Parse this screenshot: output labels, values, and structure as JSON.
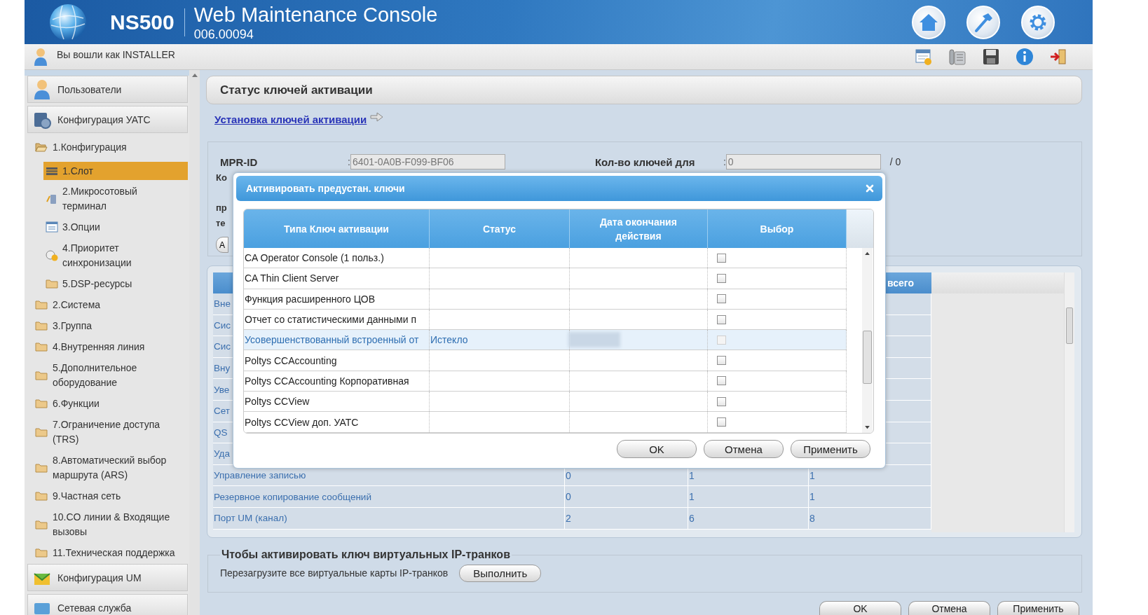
{
  "header": {
    "product": "NS500",
    "title": "Web Maintenance Console",
    "version": "006.00094"
  },
  "user_bar": {
    "text": "Вы вошли как INSTALLER"
  },
  "sidebar": {
    "sections": [
      {
        "label": "Пользователи",
        "kind": "users"
      },
      {
        "label": "Конфигурация УАТС",
        "kind": "pbx",
        "tree": [
          {
            "label": "1.Конфигурация",
            "expanded": true,
            "children": [
              {
                "label": "1.Слот",
                "kind": "slot",
                "selected": true
              },
              {
                "label": "2.Микросотовый терминал",
                "kind": "cell",
                "selected": false
              },
              {
                "label": "3.Опции",
                "kind": "options",
                "selected": false
              },
              {
                "label": "4.Приоритет синхронизации",
                "kind": "sync",
                "selected": false
              },
              {
                "label": "5.DSP-ресурсы",
                "kind": "folder",
                "selected": false
              }
            ]
          },
          {
            "label": "2.Система",
            "expanded": false
          },
          {
            "label": "3.Группа",
            "expanded": false
          },
          {
            "label": "4.Внутренняя линия",
            "expanded": false
          },
          {
            "label": "5.Дополнительное оборудование",
            "expanded": false
          },
          {
            "label": "6.Функции",
            "expanded": false
          },
          {
            "label": "7.Ограничение доступа (TRS)",
            "expanded": false
          },
          {
            "label": "8.Автоматический выбор маршрута (ARS)",
            "expanded": false
          },
          {
            "label": "9.Частная сеть",
            "expanded": false
          },
          {
            "label": "10.CO линии & Входящие вызовы",
            "expanded": false
          },
          {
            "label": "11.Техническая поддержка",
            "expanded": false
          }
        ]
      },
      {
        "label": "Конфигурация UM",
        "kind": "um"
      },
      {
        "label": "Сетевая служба",
        "kind": "network"
      }
    ]
  },
  "page": {
    "title": "Статус ключей активации",
    "link": "Установка ключей активации",
    "fields": [
      {
        "label": "MPR-ID",
        "separator": ":",
        "value": "6401-0A0B-F099-BF06"
      },
      {
        "label": "Кол-во ключей для",
        "separator": ":",
        "value": "0",
        "suffix": "/ 0"
      }
    ],
    "covered_labels": [
      "Ко",
      "пр",
      "те"
    ],
    "covered_button": "А"
  },
  "summary_table": {
    "header_visible": "всего",
    "rows": [
      {
        "name": "Вне"
      },
      {
        "name": "Сис"
      },
      {
        "name": "Сис"
      },
      {
        "name": "Вну"
      },
      {
        "name": "Уве"
      },
      {
        "name": "Сет"
      },
      {
        "name": "QS"
      },
      {
        "name": "Уда"
      },
      {
        "name": "Управление записью",
        "values": [
          "0",
          "1",
          "1"
        ]
      },
      {
        "name": "Резервное копирование сообщений",
        "values": [
          "0",
          "1",
          "1"
        ]
      },
      {
        "name": "Порт UM (канал)",
        "values": [
          "2",
          "6",
          "8"
        ]
      }
    ]
  },
  "ip_trunk": {
    "legend": "Чтобы активировать ключ виртуальных IP-транков",
    "text": "Перезагрузите все виртуальные карты IP-транков",
    "button": "Выполнить"
  },
  "footer_buttons": [
    "OK",
    "Отмена",
    "Применить"
  ],
  "dialog": {
    "title": "Активировать предустан. ключи",
    "columns": [
      "Типа Ключ активации",
      "Статус",
      "Дата окончания действия",
      "Выбор"
    ],
    "rows": [
      {
        "name": "CA Operator Console (1 польз.)",
        "disabled": false,
        "checked": false,
        "date_hidden": false
      },
      {
        "name": "CA Thin Client Server",
        "disabled": false,
        "checked": false,
        "date_hidden": false
      },
      {
        "name": "Функция расширенного ЦОВ",
        "disabled": false,
        "checked": false,
        "date_hidden": false
      },
      {
        "name": "Отчет со статистическими данными п",
        "disabled": false,
        "checked": false,
        "date_hidden": false
      },
      {
        "name": "Усовершенствованный встроенный от",
        "status": "Истекло",
        "disabled": true,
        "checked": false,
        "date_hidden": true
      },
      {
        "name": "Poltys CCAccounting",
        "disabled": false,
        "checked": false,
        "date_hidden": false
      },
      {
        "name": "Poltys CCAccounting Корпоративная",
        "disabled": false,
        "checked": false,
        "date_hidden": false
      },
      {
        "name": "Poltys CCView",
        "disabled": false,
        "checked": false,
        "date_hidden": false
      },
      {
        "name": "Poltys CCView доп. УАТС",
        "disabled": false,
        "checked": false,
        "date_hidden": false
      }
    ],
    "buttons": [
      "OK",
      "Отмена",
      "Применить"
    ]
  }
}
